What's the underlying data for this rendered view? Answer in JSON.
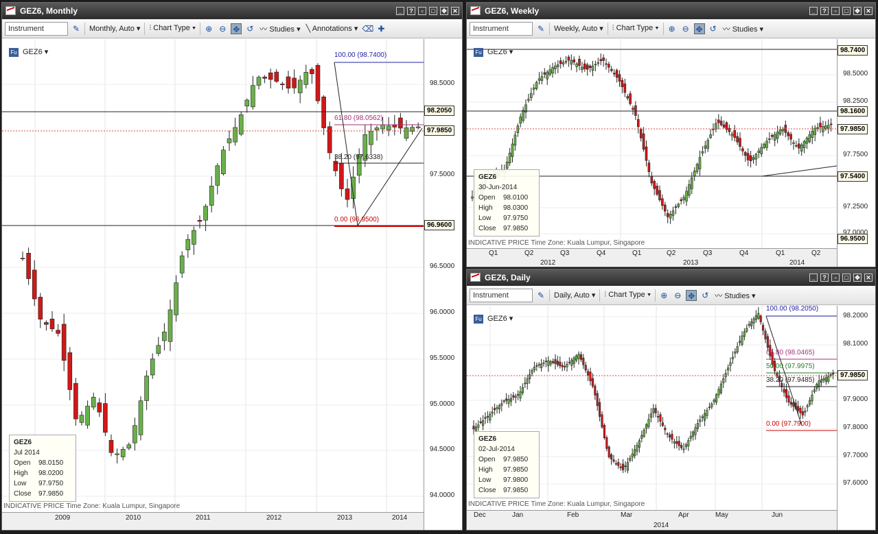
{
  "toolbar": {
    "instrument_placeholder": "Instrument",
    "chart_type": "Chart Type",
    "studies": "Studies",
    "annotations": "Annotations"
  },
  "monthly": {
    "title": "GEZ6, Monthly",
    "interval": "Monthly,",
    "auto": "Auto",
    "symbol": "GEZ6",
    "prices": [
      "98.5000",
      "97.5000",
      "96.5000",
      "96.0000",
      "95.5000",
      "95.0000",
      "94.5000",
      "94.0000"
    ],
    "tag_high": "98.2050",
    "tag_last": "97.9850",
    "tag_low": "96.9600",
    "fib": [
      "100.00 (98.7400)",
      "61.80 (98.0562)",
      "38.20 (97.6338)",
      "0.00 (96.9500)"
    ],
    "years": [
      "2009",
      "2010",
      "2011",
      "2012",
      "2013",
      "2014"
    ],
    "info": {
      "sym": "GEZ6",
      "date": "Jul 2014",
      "open": "98.0150",
      "high": "98.0200",
      "low": "97.9750",
      "close": "97.9850"
    },
    "footer": "INDICATIVE PRICE    Time Zone: Kuala Lumpur, Singapore"
  },
  "weekly": {
    "title": "GEZ6, Weekly",
    "interval": "Weekly,",
    "auto": "Auto",
    "symbol": "GEZ6",
    "prices": [
      "98.5000",
      "98.2500",
      "97.7500",
      "97.2500",
      "97.0000"
    ],
    "tag_top": "98.7400",
    "tag_high": "98.1600",
    "tag_last": "97.9850",
    "tag_mid": "97.5400",
    "tag_low": "96.9500",
    "quarters": [
      "Q1",
      "Q2",
      "Q3",
      "Q4",
      "Q1",
      "Q2",
      "Q3",
      "Q4",
      "Q1",
      "Q2"
    ],
    "years": [
      "2012",
      "2013",
      "2014"
    ],
    "info": {
      "sym": "GEZ6",
      "date": "30-Jun-2014",
      "open": "98.0100",
      "high": "98.0300",
      "low": "97.9750",
      "close": "97.9850"
    },
    "footer": "INDICATIVE PRICE    Time Zone: Kuala Lumpur, Singapore"
  },
  "daily": {
    "title": "GEZ6, Daily",
    "interval": "Daily,",
    "auto": "Auto",
    "symbol": "GEZ6",
    "prices": [
      "98.2000",
      "98.1000",
      "97.9000",
      "97.8000",
      "97.7000",
      "97.6000"
    ],
    "tag_last": "97.9850",
    "fib": [
      "100.00 (98.2050)",
      "61.80 (98.0465)",
      "50.00 (97.9975)",
      "38.20 (97.9485)",
      "0.00 (97.7900)"
    ],
    "months": [
      "Dec",
      "Jan",
      "Feb",
      "Mar",
      "Apr",
      "May",
      "Jun"
    ],
    "year": "2014",
    "info": {
      "sym": "GEZ6",
      "date": "02-Jul-2014",
      "open": "97.9850",
      "high": "97.9850",
      "low": "97.9800",
      "close": "97.9850"
    },
    "footer": "INDICATIVE PRICE    Time Zone: Kuala Lumpur, Singapore"
  },
  "labels": {
    "open": "Open",
    "high": "High",
    "low": "Low",
    "close": "Close"
  },
  "colors": {
    "up": "#6ab04c",
    "down": "#d01818",
    "fib_top": "#2222aa",
    "fib_mid": "#a0307a",
    "fib_low": "#cc0000"
  }
}
